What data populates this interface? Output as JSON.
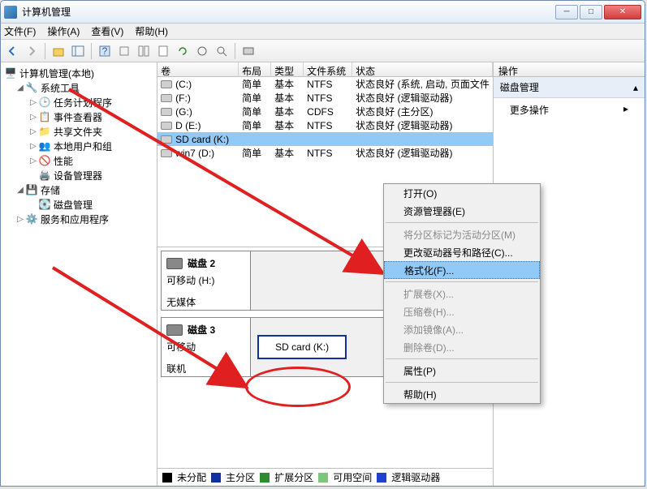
{
  "window": {
    "title": "计算机管理"
  },
  "menu": {
    "file": "文件(F)",
    "action": "操作(A)",
    "view": "查看(V)",
    "help": "帮助(H)"
  },
  "tree": {
    "root": "计算机管理(本地)",
    "systools": "系统工具",
    "tasksched": "任务计划程序",
    "eventvwr": "事件查看器",
    "sharedf": "共享文件夹",
    "localusr": "本地用户和组",
    "perf": "性能",
    "devmgr": "设备管理器",
    "storage": "存储",
    "diskmgmt": "磁盘管理",
    "svcapp": "服务和应用程序"
  },
  "vol_headers": {
    "vol": "卷",
    "layout": "布局",
    "type": "类型",
    "fs": "文件系统",
    "status": "状态"
  },
  "volumes": [
    {
      "name": "(C:)",
      "layout": "简单",
      "type": "基本",
      "fs": "NTFS",
      "status": "状态良好 (系统, 启动, 页面文件"
    },
    {
      "name": "(F:)",
      "layout": "简单",
      "type": "基本",
      "fs": "NTFS",
      "status": "状态良好 (逻辑驱动器)"
    },
    {
      "name": "(G:)",
      "layout": "简单",
      "type": "基本",
      "fs": "CDFS",
      "status": "状态良好 (主分区)"
    },
    {
      "name": "D (E:)",
      "layout": "简单",
      "type": "基本",
      "fs": "NTFS",
      "status": "状态良好 (逻辑驱动器)"
    },
    {
      "name": "SD card (K:)",
      "layout": "",
      "type": "",
      "fs": "",
      "status": ""
    },
    {
      "name": "win7 (D:)",
      "layout": "简单",
      "type": "基本",
      "fs": "NTFS",
      "status": "状态良好 (逻辑驱动器)"
    }
  ],
  "disks": {
    "d2": {
      "title": "磁盘 2",
      "meta1": "可移动 (H:)",
      "meta2": "无媒体"
    },
    "d3": {
      "title": "磁盘 3",
      "meta1": "可移动",
      "meta2": "联机",
      "part": "SD card  (K:)"
    }
  },
  "legend": {
    "unalloc": "未分配",
    "primary": "主分区",
    "extended": "扩展分区",
    "free": "可用空间",
    "logical": "逻辑驱动器"
  },
  "legend_colors": {
    "unalloc": "#000000",
    "primary": "#1030a0",
    "extended": "#2e8b2e",
    "free": "#7cc77c",
    "logical": "#2040d0"
  },
  "actions": {
    "header": "操作",
    "section": "磁盘管理",
    "more": "更多操作"
  },
  "ctx": {
    "open": "打开(O)",
    "explorer": "资源管理器(E)",
    "markactive": "将分区标记为活动分区(M)",
    "chgletter": "更改驱动器号和路径(C)...",
    "format": "格式化(F)...",
    "extend": "扩展卷(X)...",
    "shrink": "压缩卷(H)...",
    "mirror": "添加镜像(A)...",
    "delete": "删除卷(D)...",
    "props": "属性(P)",
    "help": "帮助(H)"
  }
}
